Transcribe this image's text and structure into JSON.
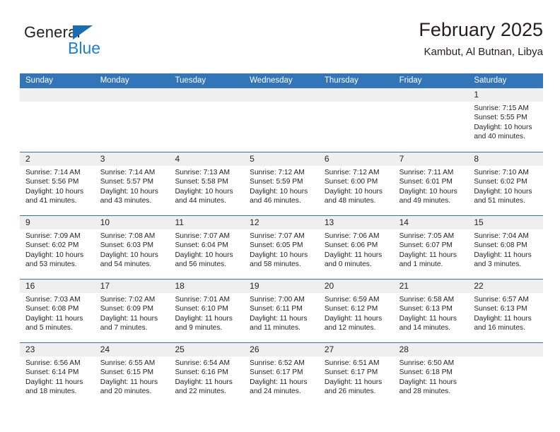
{
  "brand": {
    "name_part1": "General",
    "name_part2": "Blue",
    "triangle_color": "#1b6cb0",
    "blue_color": "#1b7fd4"
  },
  "header": {
    "title": "February 2025",
    "subtitle": "Kambut, Al Butnan, Libya"
  },
  "theme": {
    "header_blue": "#3275b8",
    "day_band_gray": "#efefef",
    "text_color": "#231f20"
  },
  "weekday_headers": [
    "Sunday",
    "Monday",
    "Tuesday",
    "Wednesday",
    "Thursday",
    "Friday",
    "Saturday"
  ],
  "weeks": [
    [
      {
        "day": "",
        "sunrise": "",
        "sunset": "",
        "daylight_line1": "",
        "daylight_line2": ""
      },
      {
        "day": "",
        "sunrise": "",
        "sunset": "",
        "daylight_line1": "",
        "daylight_line2": ""
      },
      {
        "day": "",
        "sunrise": "",
        "sunset": "",
        "daylight_line1": "",
        "daylight_line2": ""
      },
      {
        "day": "",
        "sunrise": "",
        "sunset": "",
        "daylight_line1": "",
        "daylight_line2": ""
      },
      {
        "day": "",
        "sunrise": "",
        "sunset": "",
        "daylight_line1": "",
        "daylight_line2": ""
      },
      {
        "day": "",
        "sunrise": "",
        "sunset": "",
        "daylight_line1": "",
        "daylight_line2": ""
      },
      {
        "day": "1",
        "sunrise": "Sunrise: 7:15 AM",
        "sunset": "Sunset: 5:55 PM",
        "daylight_line1": "Daylight: 10 hours",
        "daylight_line2": "and 40 minutes."
      }
    ],
    [
      {
        "day": "2",
        "sunrise": "Sunrise: 7:14 AM",
        "sunset": "Sunset: 5:56 PM",
        "daylight_line1": "Daylight: 10 hours",
        "daylight_line2": "and 41 minutes."
      },
      {
        "day": "3",
        "sunrise": "Sunrise: 7:14 AM",
        "sunset": "Sunset: 5:57 PM",
        "daylight_line1": "Daylight: 10 hours",
        "daylight_line2": "and 43 minutes."
      },
      {
        "day": "4",
        "sunrise": "Sunrise: 7:13 AM",
        "sunset": "Sunset: 5:58 PM",
        "daylight_line1": "Daylight: 10 hours",
        "daylight_line2": "and 44 minutes."
      },
      {
        "day": "5",
        "sunrise": "Sunrise: 7:12 AM",
        "sunset": "Sunset: 5:59 PM",
        "daylight_line1": "Daylight: 10 hours",
        "daylight_line2": "and 46 minutes."
      },
      {
        "day": "6",
        "sunrise": "Sunrise: 7:12 AM",
        "sunset": "Sunset: 6:00 PM",
        "daylight_line1": "Daylight: 10 hours",
        "daylight_line2": "and 48 minutes."
      },
      {
        "day": "7",
        "sunrise": "Sunrise: 7:11 AM",
        "sunset": "Sunset: 6:01 PM",
        "daylight_line1": "Daylight: 10 hours",
        "daylight_line2": "and 49 minutes."
      },
      {
        "day": "8",
        "sunrise": "Sunrise: 7:10 AM",
        "sunset": "Sunset: 6:02 PM",
        "daylight_line1": "Daylight: 10 hours",
        "daylight_line2": "and 51 minutes."
      }
    ],
    [
      {
        "day": "9",
        "sunrise": "Sunrise: 7:09 AM",
        "sunset": "Sunset: 6:02 PM",
        "daylight_line1": "Daylight: 10 hours",
        "daylight_line2": "and 53 minutes."
      },
      {
        "day": "10",
        "sunrise": "Sunrise: 7:08 AM",
        "sunset": "Sunset: 6:03 PM",
        "daylight_line1": "Daylight: 10 hours",
        "daylight_line2": "and 54 minutes."
      },
      {
        "day": "11",
        "sunrise": "Sunrise: 7:07 AM",
        "sunset": "Sunset: 6:04 PM",
        "daylight_line1": "Daylight: 10 hours",
        "daylight_line2": "and 56 minutes."
      },
      {
        "day": "12",
        "sunrise": "Sunrise: 7:07 AM",
        "sunset": "Sunset: 6:05 PM",
        "daylight_line1": "Daylight: 10 hours",
        "daylight_line2": "and 58 minutes."
      },
      {
        "day": "13",
        "sunrise": "Sunrise: 7:06 AM",
        "sunset": "Sunset: 6:06 PM",
        "daylight_line1": "Daylight: 11 hours",
        "daylight_line2": "and 0 minutes."
      },
      {
        "day": "14",
        "sunrise": "Sunrise: 7:05 AM",
        "sunset": "Sunset: 6:07 PM",
        "daylight_line1": "Daylight: 11 hours",
        "daylight_line2": "and 1 minute."
      },
      {
        "day": "15",
        "sunrise": "Sunrise: 7:04 AM",
        "sunset": "Sunset: 6:08 PM",
        "daylight_line1": "Daylight: 11 hours",
        "daylight_line2": "and 3 minutes."
      }
    ],
    [
      {
        "day": "16",
        "sunrise": "Sunrise: 7:03 AM",
        "sunset": "Sunset: 6:08 PM",
        "daylight_line1": "Daylight: 11 hours",
        "daylight_line2": "and 5 minutes."
      },
      {
        "day": "17",
        "sunrise": "Sunrise: 7:02 AM",
        "sunset": "Sunset: 6:09 PM",
        "daylight_line1": "Daylight: 11 hours",
        "daylight_line2": "and 7 minutes."
      },
      {
        "day": "18",
        "sunrise": "Sunrise: 7:01 AM",
        "sunset": "Sunset: 6:10 PM",
        "daylight_line1": "Daylight: 11 hours",
        "daylight_line2": "and 9 minutes."
      },
      {
        "day": "19",
        "sunrise": "Sunrise: 7:00 AM",
        "sunset": "Sunset: 6:11 PM",
        "daylight_line1": "Daylight: 11 hours",
        "daylight_line2": "and 11 minutes."
      },
      {
        "day": "20",
        "sunrise": "Sunrise: 6:59 AM",
        "sunset": "Sunset: 6:12 PM",
        "daylight_line1": "Daylight: 11 hours",
        "daylight_line2": "and 12 minutes."
      },
      {
        "day": "21",
        "sunrise": "Sunrise: 6:58 AM",
        "sunset": "Sunset: 6:13 PM",
        "daylight_line1": "Daylight: 11 hours",
        "daylight_line2": "and 14 minutes."
      },
      {
        "day": "22",
        "sunrise": "Sunrise: 6:57 AM",
        "sunset": "Sunset: 6:13 PM",
        "daylight_line1": "Daylight: 11 hours",
        "daylight_line2": "and 16 minutes."
      }
    ],
    [
      {
        "day": "23",
        "sunrise": "Sunrise: 6:56 AM",
        "sunset": "Sunset: 6:14 PM",
        "daylight_line1": "Daylight: 11 hours",
        "daylight_line2": "and 18 minutes."
      },
      {
        "day": "24",
        "sunrise": "Sunrise: 6:55 AM",
        "sunset": "Sunset: 6:15 PM",
        "daylight_line1": "Daylight: 11 hours",
        "daylight_line2": "and 20 minutes."
      },
      {
        "day": "25",
        "sunrise": "Sunrise: 6:54 AM",
        "sunset": "Sunset: 6:16 PM",
        "daylight_line1": "Daylight: 11 hours",
        "daylight_line2": "and 22 minutes."
      },
      {
        "day": "26",
        "sunrise": "Sunrise: 6:52 AM",
        "sunset": "Sunset: 6:17 PM",
        "daylight_line1": "Daylight: 11 hours",
        "daylight_line2": "and 24 minutes."
      },
      {
        "day": "27",
        "sunrise": "Sunrise: 6:51 AM",
        "sunset": "Sunset: 6:17 PM",
        "daylight_line1": "Daylight: 11 hours",
        "daylight_line2": "and 26 minutes."
      },
      {
        "day": "28",
        "sunrise": "Sunrise: 6:50 AM",
        "sunset": "Sunset: 6:18 PM",
        "daylight_line1": "Daylight: 11 hours",
        "daylight_line2": "and 28 minutes."
      },
      {
        "day": "",
        "sunrise": "",
        "sunset": "",
        "daylight_line1": "",
        "daylight_line2": ""
      }
    ]
  ]
}
